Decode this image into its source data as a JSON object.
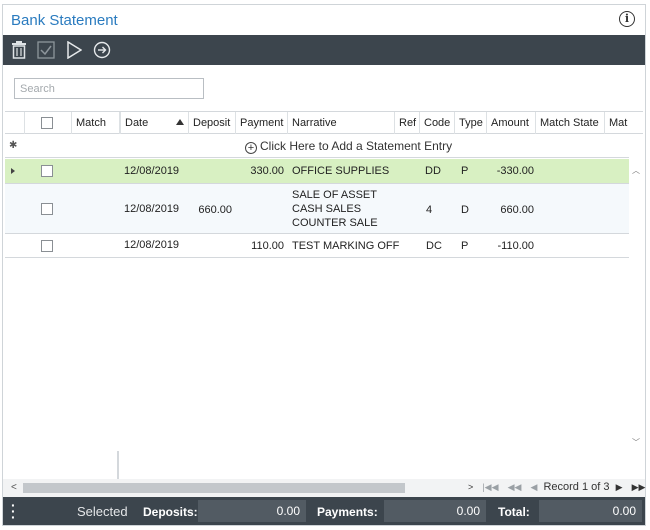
{
  "window": {
    "title": "Bank Statement",
    "info_icon": "info-icon"
  },
  "toolbar": {
    "buttons": [
      {
        "icon": "trash-icon"
      },
      {
        "icon": "check-icon"
      },
      {
        "icon": "play-icon"
      },
      {
        "icon": "arrow-circle-right-icon"
      }
    ]
  },
  "search": {
    "placeholder": "Search",
    "value": ""
  },
  "grid": {
    "columns": [
      "",
      "Match",
      "Date",
      "Deposit",
      "Payment",
      "Narrative",
      "Ref",
      "Code",
      "Type",
      "Amount",
      "Match State",
      "Mat"
    ],
    "sorted_column": "Date",
    "add_row_text": "Click Here to Add a Statement Entry",
    "rows": [
      {
        "match": "",
        "date": "12/08/2019",
        "deposit": "",
        "payment": "330.00",
        "narrative": [
          "OFFICE SUPPLIES"
        ],
        "ref": "",
        "code": "DD",
        "type": "P",
        "amount": "-330.00",
        "match_state": "",
        "selected": true
      },
      {
        "match": "",
        "date": "12/08/2019",
        "deposit": "660.00",
        "payment": "",
        "narrative": [
          "SALE OF ASSET",
          "CASH SALES",
          "COUNTER SALE"
        ],
        "ref": "",
        "code": "4",
        "type": "D",
        "amount": "660.00",
        "match_state": "",
        "selected": false
      },
      {
        "match": "",
        "date": "12/08/2019",
        "deposit": "",
        "payment": "110.00",
        "narrative": [
          "TEST MARKING OFF"
        ],
        "ref": "",
        "code": "DC",
        "type": "P",
        "amount": "-110.00",
        "match_state": "",
        "selected": false
      }
    ]
  },
  "pager": {
    "text": "Record 1 of 3"
  },
  "footer": {
    "selected_label": "Selected",
    "deposits_label": "Deposits:",
    "deposits_value": "0.00",
    "payments_label": "Payments:",
    "payments_value": "0.00",
    "total_label": "Total:",
    "total_value": "0.00"
  },
  "colors": {
    "title": "#2a7bbf",
    "toolbar_bg": "#3c454d",
    "selected_row": "#d8f0c2"
  }
}
